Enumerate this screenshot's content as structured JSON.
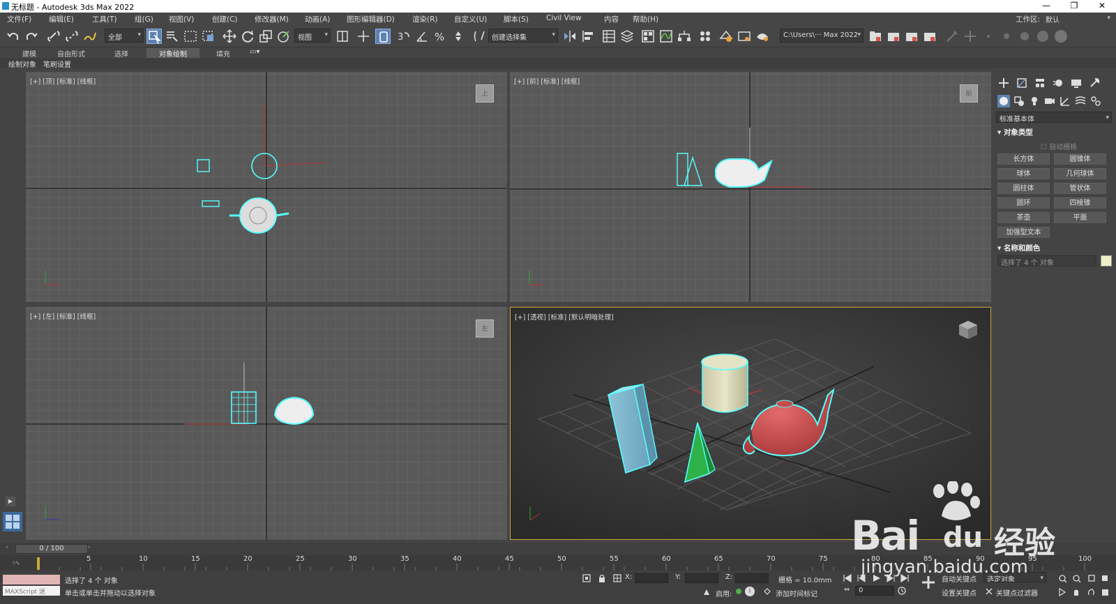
{
  "window": {
    "title": "无标题 - Autodesk 3ds Max 2022",
    "controls": [
      "—",
      "❐",
      "✕"
    ]
  },
  "menu": {
    "items": [
      "文件(F)",
      "编辑(E)",
      "工具(T)",
      "组(G)",
      "视图(V)",
      "创建(C)",
      "修改器(M)",
      "动画(A)",
      "图形编辑器(D)",
      "渲染(R)",
      "自定义(U)",
      "脚本(S)",
      "Civil View",
      "内容",
      "帮助(H)"
    ],
    "workspace_label": "工作区:",
    "workspace_value": "默认"
  },
  "toolbar": {
    "selection_filter": "全部",
    "ref_coord": "视图",
    "named_selection": "创建选择集",
    "project_path": "C:\\Users\\··· Max 2022"
  },
  "ribbon": {
    "tabs": [
      "建模",
      "自由形式",
      "选择",
      "对象绘制",
      "填充"
    ],
    "active_tab": "对象绘制",
    "sub_items": [
      "绘制对象",
      "笔刷设置"
    ]
  },
  "viewports": {
    "top": {
      "label": "[+] [顶] [标准] [线框]",
      "cube": "上"
    },
    "front": {
      "label": "[+] [前] [标准] [线框]",
      "cube": "前"
    },
    "left": {
      "label": "[+] [左] [标准] [线框]",
      "cube": "左"
    },
    "perspective": {
      "label": "[+] [透视] [标准] [默认明暗处理]"
    }
  },
  "command_panel": {
    "category": "标准基本体",
    "section_object_type": "对象类型",
    "autogrid": "自动栅格",
    "buttons": [
      "长方体",
      "圆锥体",
      "球体",
      "几何球体",
      "圆柱体",
      "管状体",
      "圆环",
      "四棱锥",
      "茶壶",
      "平面",
      "加强型文本"
    ],
    "section_name_color": "名称和颜色",
    "name_field": "选择了 4 个 对象",
    "color_swatch": "#f0f0c8"
  },
  "timeline": {
    "frame_display": "0 / 100",
    "ticks": [
      "5",
      "10",
      "15",
      "20",
      "25",
      "30",
      "35",
      "40",
      "45",
      "50",
      "55",
      "60",
      "65",
      "70",
      "75",
      "80",
      "85",
      "90",
      "95",
      "100"
    ]
  },
  "status": {
    "maxscript": "MAXScript 迷",
    "selection_info": "选择了 4 个 对象",
    "prompt": "单击或单击并拖动以选择对象",
    "x_label": "X:",
    "y_label": "Y:",
    "z_label": "Z:",
    "grid": "栅格 = 10.0mm",
    "enable_label": "启用:",
    "add_time_tag": "添加时间标记",
    "auto_key": "自动关键点",
    "set_key": "设置关键点",
    "key_mode": "选定对象",
    "key_filters": "关键点过滤器",
    "frame_field": "0"
  },
  "watermark": {
    "text_big": "Bai",
    "text_cn": "经验",
    "url": "jingyan.baidu.com"
  }
}
